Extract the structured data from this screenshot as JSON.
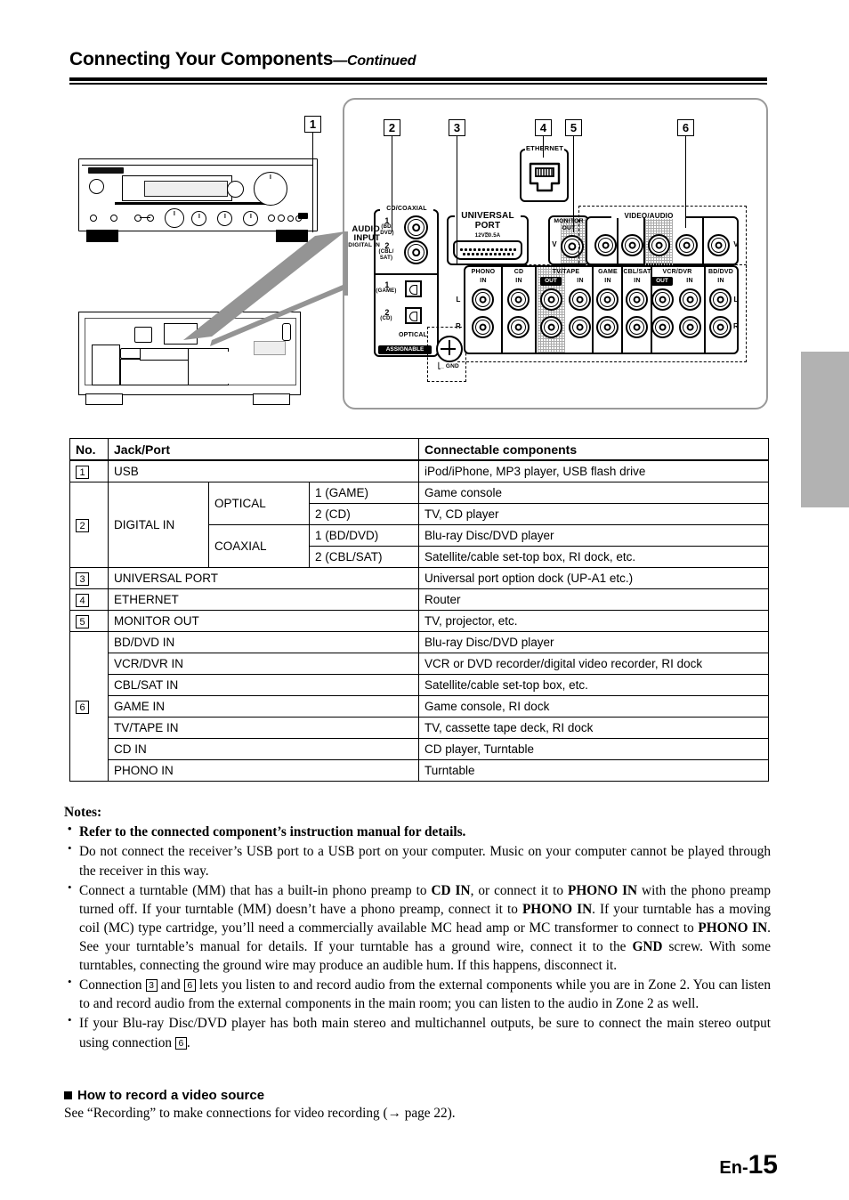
{
  "header": {
    "title": "Connecting Your Components",
    "continued": "—Continued"
  },
  "diagram": {
    "callouts": [
      "1",
      "2",
      "3",
      "4",
      "5",
      "6"
    ],
    "rear_panel": {
      "audio_input": {
        "group_label_1": "AUDIO",
        "group_label_2": "INPUT",
        "group_label_3": "DIGITAL IN",
        "coaxial_header": "CD/COAXIAL",
        "coax_1_num": "1",
        "coax_1_name": "(BD/",
        "coax_1_name2": "DVD)",
        "coax_2_num": "2",
        "coax_2_name": "(CBL/",
        "coax_2_name2": "SAT)",
        "opt_1_num": "1",
        "opt_1_name": "(GAME)",
        "opt_2_num": "2",
        "opt_2_name": "(CD)",
        "optical_label": "OPTICAL",
        "assignable_label": "ASSIGNABLE"
      },
      "gnd_label": "GND",
      "universal_port": {
        "line1": "UNIVERSAL",
        "line2": "PORT",
        "rating": "12V⍰0.5A"
      },
      "ethernet_label": "ETHERNET",
      "monitor_out": {
        "line1": "MONITOR",
        "line2": "OUT",
        "v": "V"
      },
      "video_audio_label": "VIDEO/AUDIO",
      "jack_columns": [
        {
          "name": "PHONO",
          "sub": "IN"
        },
        {
          "name": "CD",
          "sub": "IN"
        },
        {
          "name": "TV/TAPE",
          "sub_out": "OUT",
          "sub": "IN"
        },
        {
          "name": "GAME",
          "sub": "IN"
        },
        {
          "name": "CBL/SAT",
          "sub": "IN"
        },
        {
          "name": "VCR/DVR",
          "sub_out": "OUT",
          "sub": "IN"
        },
        {
          "name": "BD/DVD",
          "sub": "IN"
        }
      ],
      "row_labels": {
        "v": "V",
        "l": "L",
        "r": "R"
      }
    }
  },
  "table": {
    "headers": [
      "No.",
      "Jack/Port",
      "Connectable components"
    ],
    "rows": [
      {
        "no": "1",
        "jack": "USB",
        "sub1": "",
        "sub2": "",
        "comp": "iPod/iPhone, MP3 player, USB flash drive"
      },
      {
        "no": "2",
        "jack": "DIGITAL IN",
        "sub1": "OPTICAL",
        "sub2": "1 (GAME)",
        "comp": "Game console"
      },
      {
        "no": "",
        "jack": "",
        "sub1": "",
        "sub2": "2 (CD)",
        "comp": "TV, CD player"
      },
      {
        "no": "",
        "jack": "",
        "sub1": "COAXIAL",
        "sub2": "1 (BD/DVD)",
        "comp": "Blu-ray Disc/DVD player"
      },
      {
        "no": "",
        "jack": "",
        "sub1": "",
        "sub2": "2 (CBL/SAT)",
        "comp": "Satellite/cable set-top box, RI dock, etc."
      },
      {
        "no": "3",
        "jack": "UNIVERSAL PORT",
        "sub1": "",
        "sub2": "",
        "comp": "Universal port option dock (UP-A1 etc.)"
      },
      {
        "no": "4",
        "jack": "ETHERNET",
        "sub1": "",
        "sub2": "",
        "comp": "Router"
      },
      {
        "no": "5",
        "jack": "MONITOR OUT",
        "sub1": "",
        "sub2": "",
        "comp": "TV, projector, etc."
      },
      {
        "no": "6",
        "jack": "BD/DVD IN",
        "sub1": "",
        "sub2": "",
        "comp": "Blu-ray Disc/DVD player"
      },
      {
        "no": "",
        "jack": "VCR/DVR IN",
        "sub1": "",
        "sub2": "",
        "comp": "VCR or DVD recorder/digital video recorder, RI dock"
      },
      {
        "no": "",
        "jack": "CBL/SAT IN",
        "sub1": "",
        "sub2": "",
        "comp": "Satellite/cable set-top box, etc."
      },
      {
        "no": "",
        "jack": "GAME IN",
        "sub1": "",
        "sub2": "",
        "comp": "Game console, RI dock"
      },
      {
        "no": "",
        "jack": "TV/TAPE IN",
        "sub1": "",
        "sub2": "",
        "comp": "TV, cassette tape deck, RI dock"
      },
      {
        "no": "",
        "jack": "CD IN",
        "sub1": "",
        "sub2": "",
        "comp": "CD player, Turntable"
      },
      {
        "no": "",
        "jack": "PHONO IN",
        "sub1": "",
        "sub2": "",
        "comp": "Turntable"
      }
    ]
  },
  "notes": {
    "heading": "Notes:",
    "item1": "Refer to the connected component’s instruction manual for details.",
    "item2": "Do not connect the receiver’s USB port to a USB port on your computer. Music on your computer cannot be played through the receiver in this way.",
    "item3_a": "Connect a turntable (MM) that has a built-in phono preamp to ",
    "item3_b1": "CD IN",
    "item3_c": ", or connect it to ",
    "item3_b2": "PHONO IN",
    "item3_d": " with the phono preamp turned off. If your turntable (MM) doesn’t have a phono preamp, connect it to ",
    "item3_b3": "PHONO IN",
    "item3_e": ". If your turntable has a moving coil (MC) type cartridge, you’ll need a commercially available MC head amp or MC transformer to connect to ",
    "item3_b4": "PHONO IN",
    "item3_f": ". See your turntable’s manual for details. If your turntable has a ground wire, connect it to the ",
    "item3_b5": "GND",
    "item3_g": " screw. With some turntables, connecting the ground wire may produce an audible hum. If this happens, disconnect it.",
    "item4_a": "Connection ",
    "item4_n1": "3",
    "item4_b": " and ",
    "item4_n2": "6",
    "item4_c": " lets you listen to and record audio from the external components while you are in Zone 2. You can listen to and record audio from the external components in the main room; you can listen to the audio in Zone 2 as well.",
    "item5_a": "If your Blu-ray Disc/DVD player has both main stereo and multichannel outputs, be sure to connect the main stereo output using connection ",
    "item5_n": "6",
    "item5_b": "."
  },
  "section": {
    "heading": "How to record a video source",
    "body": "See “Recording” to make connections for video recording (→ page 22)."
  },
  "footer": {
    "prefix": "En-",
    "page": "15"
  },
  "colors": {
    "side_tab": "#b2b2b2",
    "panel_border": "#9a9a9a",
    "ink": "#000000"
  }
}
